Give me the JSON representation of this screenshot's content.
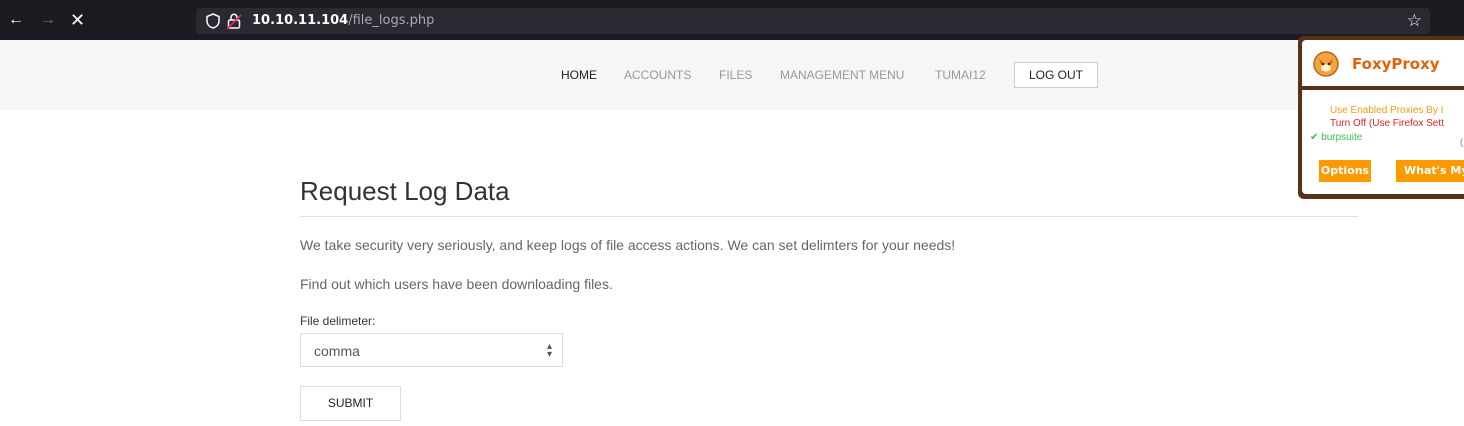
{
  "browser": {
    "url_host": "10.10.11.104",
    "url_path": "/file_logs.php",
    "back_icon": "←",
    "forward_icon": "→",
    "stop_icon": "✕",
    "star_icon": "☆"
  },
  "nav": {
    "items": [
      {
        "label": "HOME",
        "active": true
      },
      {
        "label": "ACCOUNTS",
        "active": false
      },
      {
        "label": "FILES",
        "active": false
      },
      {
        "label": "MANAGEMENT MENU",
        "active": false
      },
      {
        "label": "TUMAI12",
        "active": false
      }
    ],
    "logout_label": "LOG OUT"
  },
  "main": {
    "title": "Request Log Data",
    "paragraph1": "We take security very seriously, and keep logs of file access actions. We can set delimters for your needs!",
    "paragraph2": "Find out which users have been downloading files.",
    "delimiter_label": "File delimeter:",
    "delimiter_value": "comma",
    "submit_label": "SUBMIT"
  },
  "foxyproxy": {
    "title": "FoxyProxy",
    "line1": "Use Enabled Proxies By I",
    "line2": "Turn Off (Use Firefox Sett",
    "line3": "✔ burpsuite",
    "paren": "(",
    "options_label": "Options",
    "whats_my_ip_label": "What's My",
    "colors": {
      "accent": "#ff9900",
      "frame": "#5a3017",
      "title": "#e36209"
    }
  }
}
